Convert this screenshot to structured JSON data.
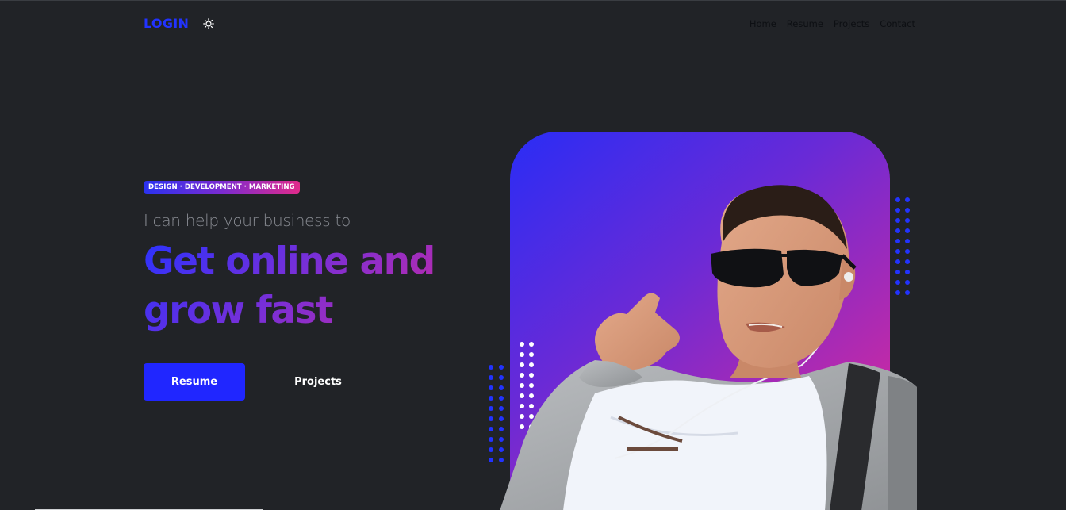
{
  "header": {
    "logo": "LOGIN",
    "theme_icon": "sun-icon",
    "nav": [
      "Home",
      "Resume",
      "Projects",
      "Contact"
    ]
  },
  "hero": {
    "badge": "DESIGN · DEVELOPMENT · MARKETING",
    "subheading": "I can help your business to",
    "headline_line1": "Get online and",
    "headline_line2": "grow fast",
    "buttons": {
      "primary": "Resume",
      "secondary": "Projects"
    }
  },
  "colors": {
    "background": "#212327",
    "accent": "#2026ff",
    "gradient_start": "#2a2df5",
    "gradient_end": "#d52a8e"
  }
}
